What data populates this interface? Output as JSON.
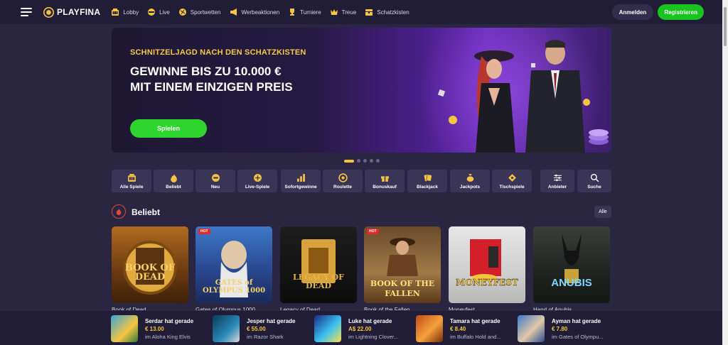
{
  "brand": {
    "name": "PLAYFINA"
  },
  "nav": {
    "items": [
      {
        "label": "Lobby",
        "icon": "slot-machine-icon"
      },
      {
        "label": "Live",
        "icon": "live-icon"
      },
      {
        "label": "Sportwetten",
        "icon": "ball-icon"
      },
      {
        "label": "Werbeaktionen",
        "icon": "megaphone-icon"
      },
      {
        "label": "Turniere",
        "icon": "trophy-icon"
      },
      {
        "label": "Treue",
        "icon": "crown-icon"
      },
      {
        "label": "Schatzkisten",
        "icon": "chest-icon"
      }
    ],
    "login": "Anmelden",
    "register": "Registrieren"
  },
  "hero": {
    "kicker": "SCHNITZELJAGD NACH DEN SCHATZKISTEN",
    "title_line1": "GEWINNE BIS ZU 10.000 €",
    "title_line2": "MIT EINEM EINZIGEN PREIS",
    "cta": "Spielen",
    "slides": 5,
    "active_slide": 1
  },
  "categories": [
    {
      "label": "Alle Spiele",
      "icon": "slot-machine-icon"
    },
    {
      "label": "Beliebt",
      "icon": "flame-icon"
    },
    {
      "label": "Neu",
      "icon": "new-badge-icon"
    },
    {
      "label": "Live-Spiele",
      "icon": "live-icon"
    },
    {
      "label": "Sofortgewinne",
      "icon": "bar-chart-icon"
    },
    {
      "label": "Roulette",
      "icon": "roulette-icon"
    },
    {
      "label": "Bonuskauf",
      "icon": "gift-icon"
    },
    {
      "label": "Blackjack",
      "icon": "cards-icon"
    },
    {
      "label": "Jackpots",
      "icon": "money-bag-icon"
    },
    {
      "label": "Tischspiele",
      "icon": "diamond-icon"
    },
    {
      "label": "Anbieter",
      "icon": "sliders-icon"
    },
    {
      "label": "Suche",
      "icon": "search-icon"
    }
  ],
  "section": {
    "title": "Beliebt",
    "all_label": "Alle"
  },
  "games": [
    {
      "art": "BOOK OF DEAD",
      "name": "Book of Dead",
      "hot": false
    },
    {
      "art": "GATES of OLYMPUS 1000",
      "name": "Gates of Olympus 1000",
      "hot": true,
      "hot_label": "HOT"
    },
    {
      "art": "LEGACY OF DEAD",
      "name": "Legacy of Dead",
      "hot": false
    },
    {
      "art": "BOOK OF THE FALLEN",
      "name": "Book of the Fallen",
      "hot": true,
      "hot_label": "HOT"
    },
    {
      "art": "MONEYFEST",
      "name": "Moneyfest",
      "hot": false
    },
    {
      "art": "ANUBIS",
      "name": "Hand of Anubis",
      "hot": false
    }
  ],
  "ticker": [
    {
      "who": "Serdar hat gerade",
      "amount": "€ 13.00",
      "where": "im Aloha King Elvis"
    },
    {
      "who": "Jesper hat gerade",
      "amount": "€ 55.00",
      "where": "im Razor Shark"
    },
    {
      "who": "Luke hat gerade",
      "amount": "A$ 22.00",
      "where": "im Lightning Clover..."
    },
    {
      "who": "Tamara hat gerade",
      "amount": "€ 8.40",
      "where": "im Buffalo Hold and..."
    },
    {
      "who": "Ayman hat gerade",
      "amount": "€ 7.80",
      "where": "im Gates of Olympu..."
    }
  ],
  "colors": {
    "accent_green": "#18c41f",
    "gold": "#f5c542",
    "background": "#2a2540",
    "topbar": "#221d36"
  }
}
